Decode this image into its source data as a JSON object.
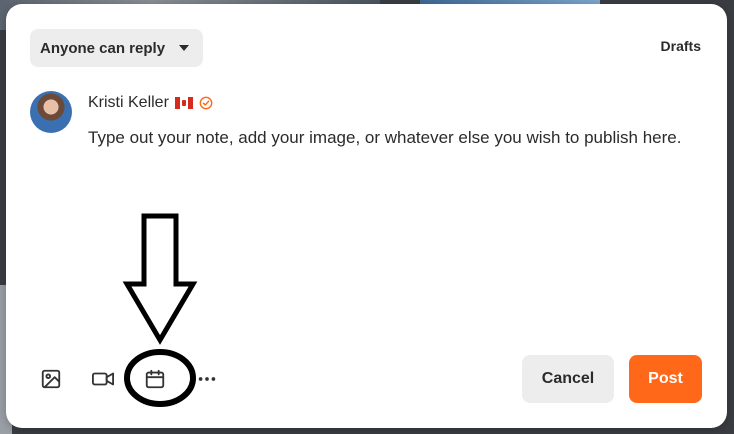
{
  "composer": {
    "reply_setting": "Anyone can reply",
    "drafts_label": "Drafts",
    "author_name": "Kristi Keller",
    "flag_icon": "canada-flag-icon",
    "verified_color": "#ff6719",
    "note_text": "Type out your note, add your image, or whatever else you wish to publish here."
  },
  "toolbar": {
    "icons": [
      "image-icon",
      "video-icon",
      "calendar-icon",
      "more-icon"
    ]
  },
  "actions": {
    "cancel_label": "Cancel",
    "post_label": "Post",
    "post_color": "#ff6719"
  }
}
